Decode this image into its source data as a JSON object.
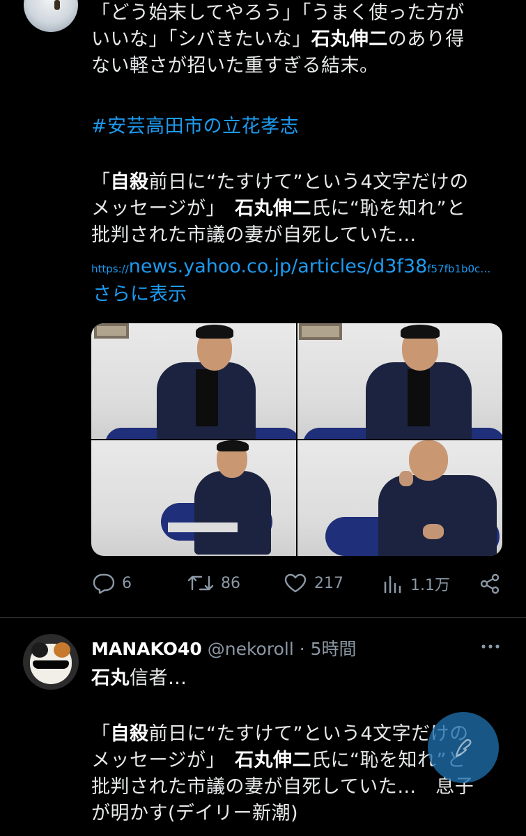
{
  "tweet1": {
    "line1": "「どう始末してやろう」「うまく使った方が",
    "line2_a": "いいな」「シバきたいな」",
    "line2_b": "石丸伸二",
    "line2_c": "のあり得",
    "line3": "ない軽さが招いた重すぎる結末。",
    "hashtag": "#安芸高田市の立花孝志",
    "quote_l1_a": "「",
    "quote_l1_b": "自殺",
    "quote_l1_c": "前日に“たすけて”という4文字だけの",
    "quote_l2_a": "メッセージが」　",
    "quote_l2_b": "石丸伸二",
    "quote_l2_c": "氏に“恥を知れ”と",
    "quote_l3": "批判された市議の妻が自死していた…",
    "link_small": "https://",
    "link_large": "news.yahoo.co.jp/articles/d3f38",
    "link_tail": "f57fb1b0c…",
    "show_more": "さらに表示",
    "actions": {
      "reply_count": "6",
      "retweet_count": "86",
      "like_count": "217",
      "views_count": "1.1万"
    }
  },
  "reply": {
    "name": "MANAKO40",
    "handle": "@nekoroll",
    "dot": "·",
    "time": "5時間",
    "l1_a": "石丸",
    "l1_b": "信者…",
    "quote_l1_a": "「",
    "quote_l1_b": "自殺",
    "quote_l1_c": "前日に“たすけて”という4文字だけの",
    "quote_l2_a": "メッセージが」　",
    "quote_l2_b": "石丸伸二",
    "quote_l2_c": "氏に“恥を知れ”と",
    "quote_l3": "批判された市議の妻が自死していた…　息子",
    "quote_l4": "が明かす(デイリー新潮)"
  },
  "colors": {
    "background": "#000000",
    "text": "#e7e9ea",
    "accent": "#1d9bf0",
    "muted": "#8b98a5"
  },
  "icons": [
    "reply-icon",
    "retweet-icon",
    "like-icon",
    "views-icon",
    "share-icon",
    "more-icon",
    "compose-icon"
  ]
}
